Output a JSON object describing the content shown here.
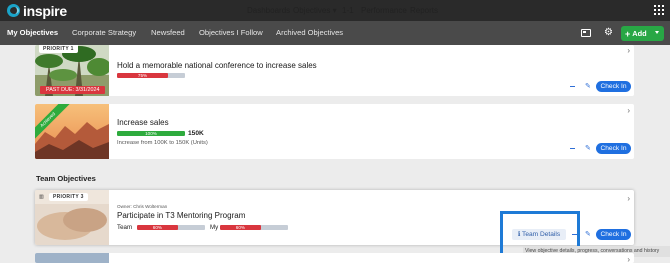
{
  "brand": {
    "name": "inspire"
  },
  "topnav": {
    "items": [
      {
        "label": "Dashboards"
      },
      {
        "label": "Objectives ▾"
      },
      {
        "label": "1-1"
      },
      {
        "label": "Performance"
      },
      {
        "label": "Reports"
      }
    ]
  },
  "subnav": {
    "tabs": [
      {
        "label": "My Objectives",
        "active": true
      },
      {
        "label": "Corporate Strategy"
      },
      {
        "label": "Newsfeed"
      },
      {
        "label": "Objectives I Follow"
      },
      {
        "label": "Archived Objectives"
      }
    ],
    "add_label": "Add"
  },
  "objectives": [
    {
      "priority": "PRIORITY 1",
      "title": "Hold a memorable national conference to increase sales",
      "progress": 75,
      "progress_label": "75%",
      "status": "PAST DUE: 3/31/2024",
      "checkin_label": "Check In"
    },
    {
      "ribbon": "Achieved",
      "title": "Increase sales",
      "progress": 100,
      "progress_label": "100%",
      "value_label": "150K",
      "description": "Increase from 100K to 150K (Units)",
      "checkin_label": "Check In"
    }
  ],
  "team_section": {
    "heading": "Team Objectives"
  },
  "team_objectives": [
    {
      "priority": "PRIORITY 3",
      "owner": "Owner: Chris Wolterman",
      "title": "Participate in T3 Mentoring Program",
      "team_label": "Team",
      "team_progress": 60,
      "team_progress_label": "60%",
      "my_label": "My",
      "my_progress": 60,
      "my_progress_label": "60%",
      "team_details_label": "Team Details",
      "checkin_label": "Check In",
      "tooltip": "View objective details, progress, conversations and history"
    }
  ],
  "colors": {
    "topbar": "#2a2a2a",
    "subbar": "#4a4a4a",
    "accent_green": "#28a745",
    "checkin_blue": "#1f6fe0",
    "progress_red": "#d9363e",
    "progress_green": "#2eab3d",
    "highlight_blue": "#1e7ad6"
  },
  "icons": [
    "chevron-right-icon",
    "pencil-icon",
    "minus-icon",
    "calendar-icon",
    "gear-icon",
    "apps-grid-icon",
    "info-icon",
    "chart-icon"
  ]
}
